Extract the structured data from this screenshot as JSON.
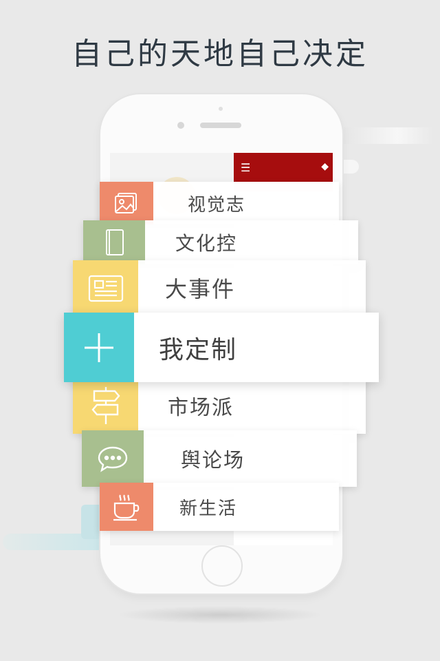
{
  "headline": "自己的天地自己决定",
  "colors": {
    "salmon": "#ee8a6b",
    "sage": "#a8bf8f",
    "yellow": "#f7d872",
    "teal": "#4fcdd3",
    "header_red": "#a60d0e"
  },
  "menu": [
    {
      "label": "视觉志",
      "icon": "image-icon"
    },
    {
      "label": "文化控",
      "icon": "book-icon"
    },
    {
      "label": "大事件",
      "icon": "newspaper-icon"
    },
    {
      "label": "我定制",
      "icon": "plus-icon"
    },
    {
      "label": "市场派",
      "icon": "signpost-icon"
    },
    {
      "label": "舆论场",
      "icon": "chat-bubble-icon"
    },
    {
      "label": "新生活",
      "icon": "coffee-cup-icon"
    }
  ]
}
